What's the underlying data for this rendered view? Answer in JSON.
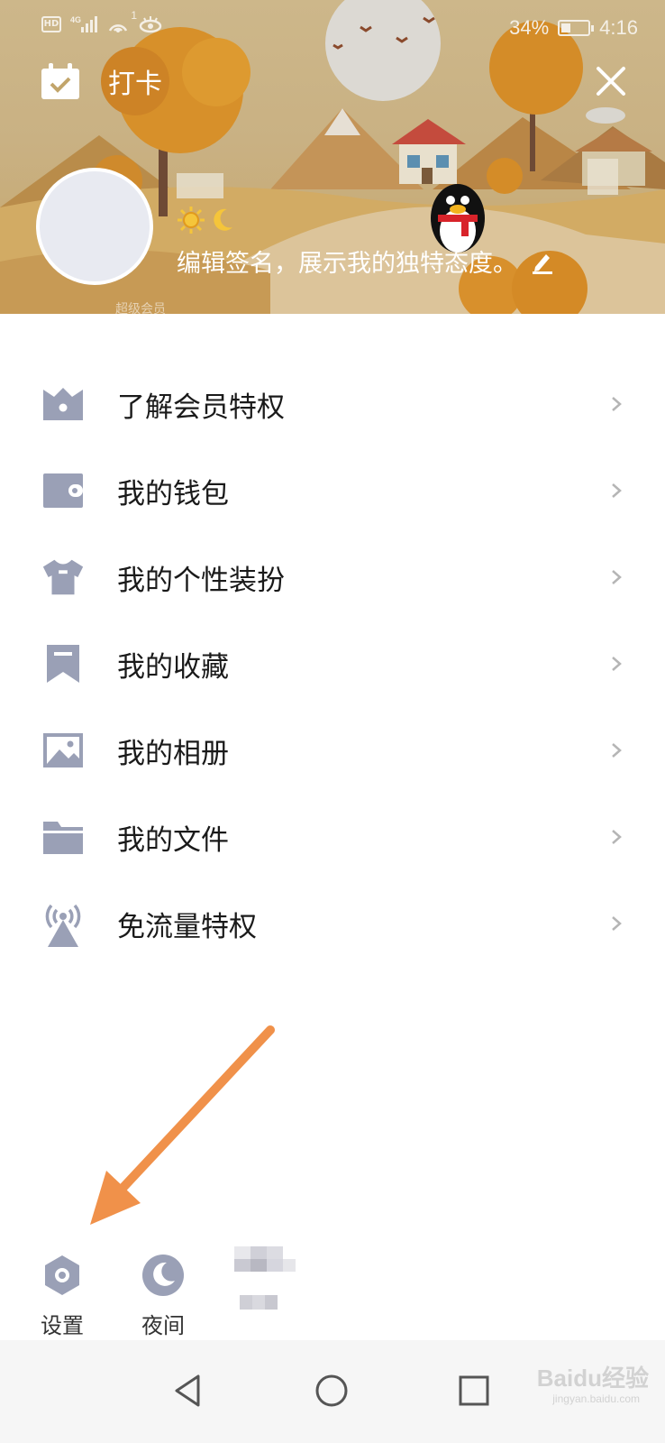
{
  "status_bar": {
    "network": "4G",
    "notification_count": "1",
    "battery": "34%",
    "battery_level": 0.34,
    "time": "4:16"
  },
  "header": {
    "checkin_label": "打卡",
    "signature": "编辑签名，展示我的独特态度。",
    "bottom_watermark_text": "超级会员"
  },
  "menu": {
    "items": [
      {
        "label": "了解会员特权",
        "icon": "vip-crown-icon"
      },
      {
        "label": "我的钱包",
        "icon": "wallet-icon"
      },
      {
        "label": "我的个性装扮",
        "icon": "tshirt-icon"
      },
      {
        "label": "我的收藏",
        "icon": "bookmark-icon"
      },
      {
        "label": "我的相册",
        "icon": "image-icon"
      },
      {
        "label": "我的文件",
        "icon": "folder-icon"
      },
      {
        "label": "免流量特权",
        "icon": "signal-tower-icon"
      }
    ]
  },
  "bottom_actions": {
    "settings_label": "设置",
    "night_label": "夜间"
  },
  "watermark": {
    "brand": "Baidu经验",
    "url": "jingyan.baidu.com"
  },
  "colors": {
    "icon_gray": "#9aa0b6",
    "annotation_arrow": "#f0914a",
    "text_primary": "#1a1a1a"
  }
}
